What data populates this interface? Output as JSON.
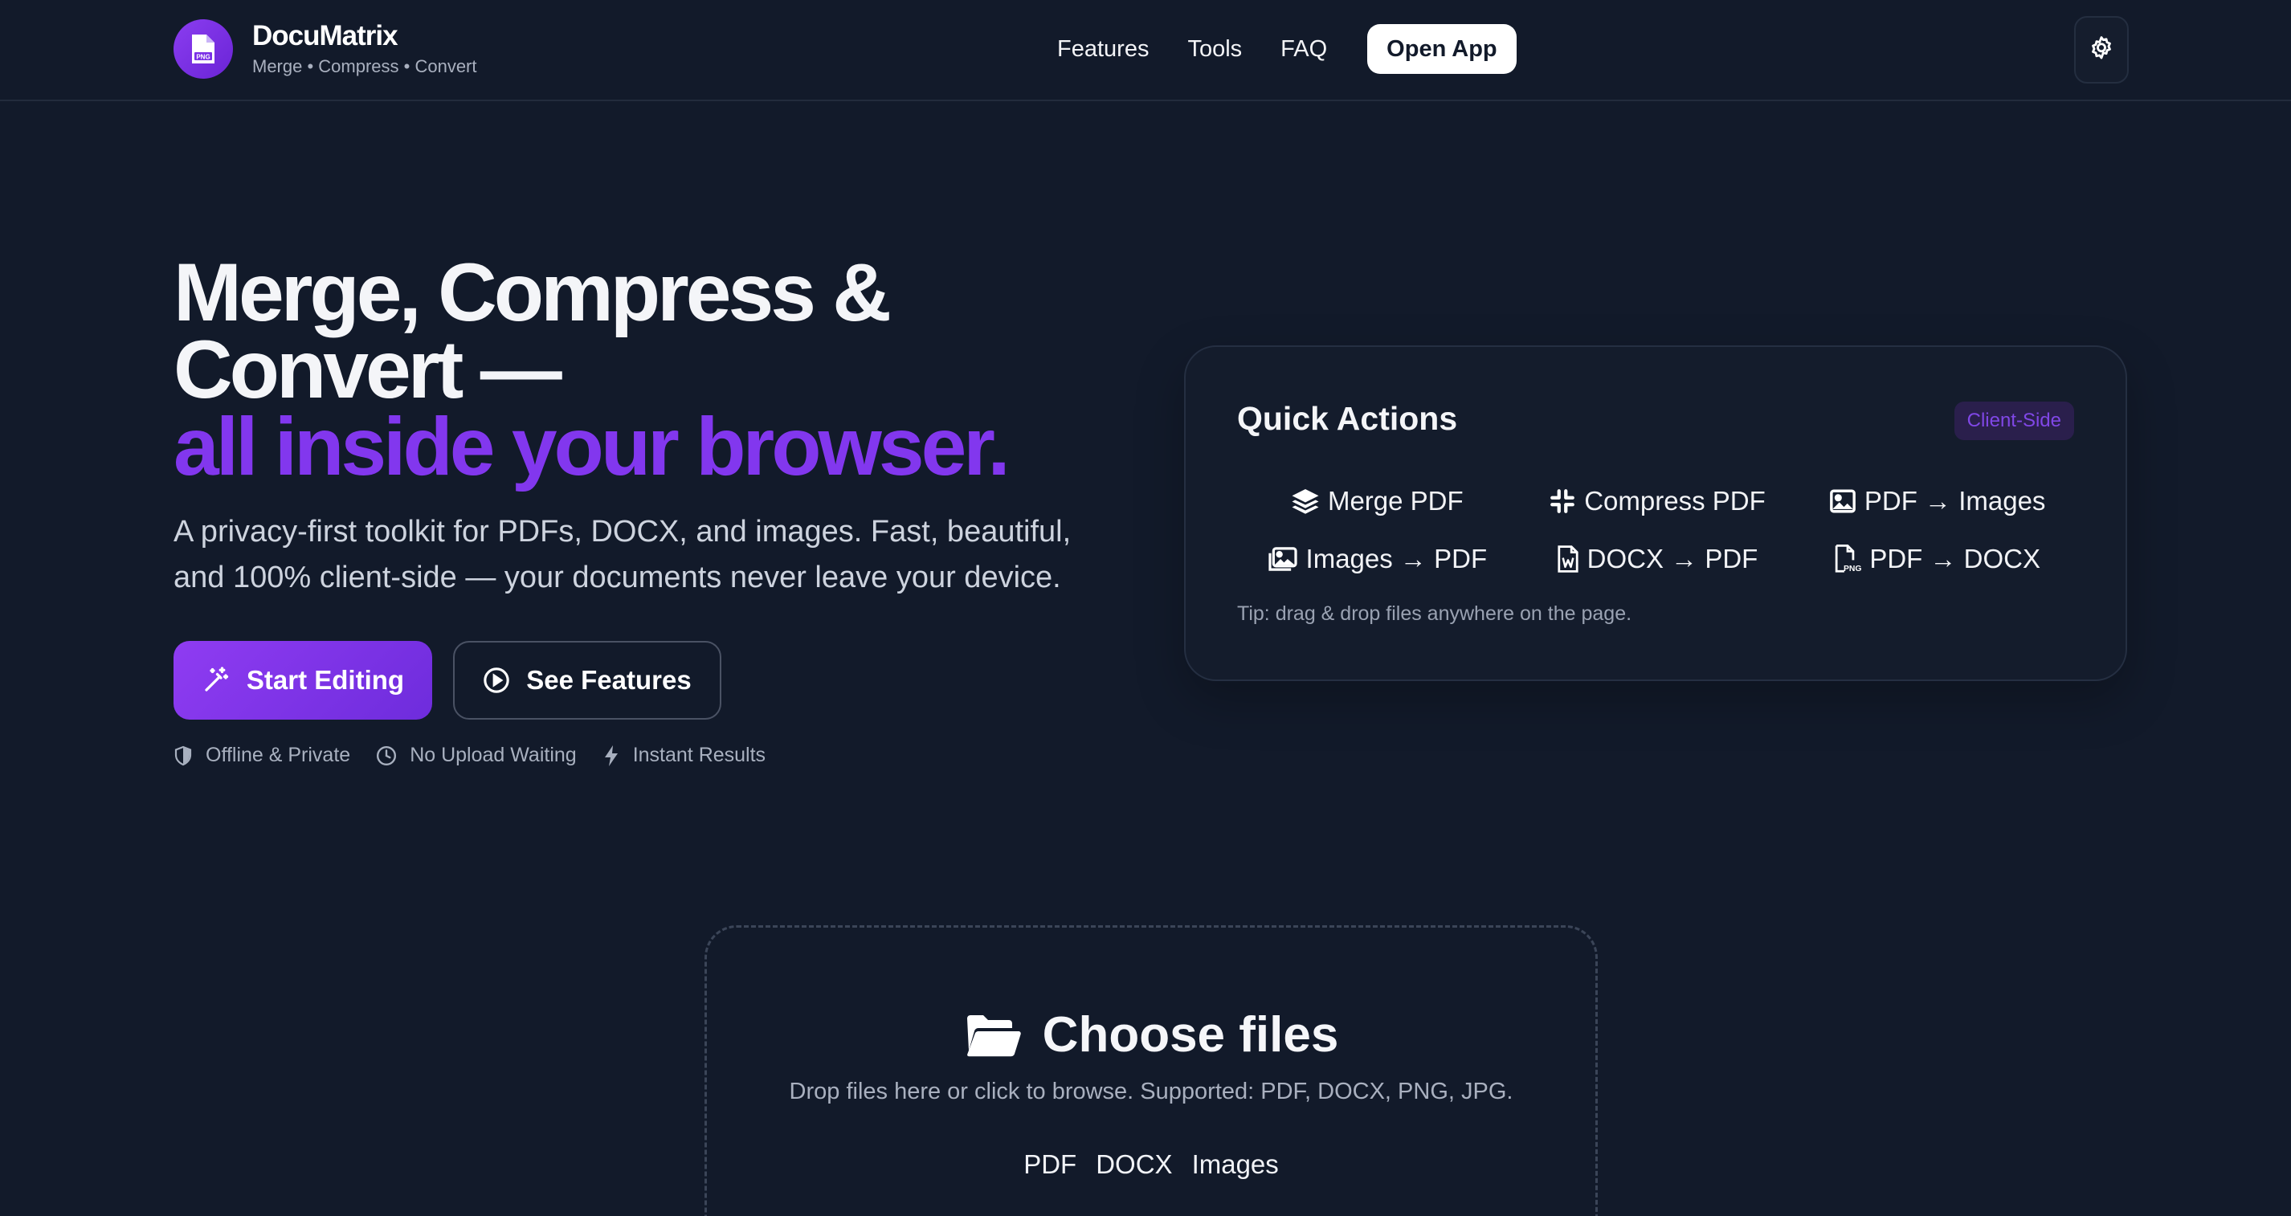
{
  "brand": {
    "name": "DocuMatrix",
    "tagline": "Merge • Compress • Convert",
    "logo_icon": "file-png-icon",
    "accent": "#8237ee"
  },
  "nav": {
    "links": [
      "Features",
      "Tools",
      "FAQ"
    ],
    "open_app": "Open App",
    "settings_icon": "gear-icon"
  },
  "hero": {
    "title_line1": "Merge, Compress &",
    "title_line2": "Convert —",
    "title_accent": "all inside your browser.",
    "subtitle": "A privacy-first toolkit for PDFs, DOCX, and images. Fast, beautiful, and 100% client-side — your documents never leave your device.",
    "primary_cta": "Start Editing",
    "secondary_cta": "See Features",
    "badges": [
      {
        "label": "Offline & Private",
        "icon": "shield-icon"
      },
      {
        "label": "No Upload Waiting",
        "icon": "clock-icon"
      },
      {
        "label": "Instant Results",
        "icon": "bolt-icon"
      }
    ]
  },
  "quick_actions": {
    "title": "Quick Actions",
    "badge": "Client-Side",
    "items": [
      {
        "label": "Merge PDF",
        "icon": "layers-icon"
      },
      {
        "label": "Compress PDF",
        "icon": "compress-icon"
      },
      {
        "label": "PDF → Images",
        "icon": "image-icon"
      },
      {
        "label": "Images → PDF",
        "icon": "images-icon"
      },
      {
        "label": "DOCX → PDF",
        "icon": "file-word-icon"
      },
      {
        "label": "PDF → DOCX",
        "icon": "file-png-icon"
      }
    ],
    "tip": "Tip: drag & drop files anywhere on the page."
  },
  "dropzone": {
    "title": "Choose files",
    "subtitle": "Drop files here or click to browse. Supported: PDF, DOCX, PNG, JPG.",
    "types": [
      "PDF",
      "DOCX",
      "Images"
    ],
    "icon": "folder-open-icon"
  }
}
